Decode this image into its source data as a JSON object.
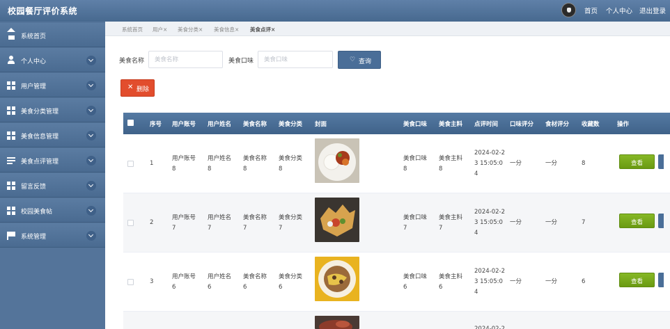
{
  "app": {
    "title": "校园餐厅评价系统"
  },
  "topnav": {
    "home": "首页",
    "profile": "个人中心",
    "logout": "退出登录"
  },
  "sidebar": {
    "items": [
      {
        "label": "系统首页",
        "icon": "home-icon"
      },
      {
        "label": "个人中心",
        "icon": "user-icon"
      },
      {
        "label": "用户管理",
        "icon": "grid-icon"
      },
      {
        "label": "美食分类管理",
        "icon": "grid-icon"
      },
      {
        "label": "美食信息管理",
        "icon": "grid-icon"
      },
      {
        "label": "美食点评管理",
        "icon": "list-icon"
      },
      {
        "label": "留言反馈",
        "icon": "grid-icon"
      },
      {
        "label": "校园美食帖",
        "icon": "grid-icon"
      },
      {
        "label": "系统管理",
        "icon": "flag-icon"
      }
    ]
  },
  "tabs": [
    "系统首页",
    "用户×",
    "美食分类×",
    "美食信息×",
    "美食点评×"
  ],
  "search": {
    "name_label": "美食名称",
    "name_placeholder": "美食名称",
    "taste_label": "美食口味",
    "taste_placeholder": "美食口味",
    "query_button": "查询",
    "delete_button": "删除"
  },
  "table": {
    "headers": [
      "序号",
      "用户账号",
      "用户姓名",
      "美食名称",
      "美食分类",
      "封面",
      "美食口味",
      "美食主料",
      "点评时间",
      "口味评分",
      "食材评分",
      "收藏数",
      "操作"
    ],
    "view_label": "查看",
    "rows": [
      {
        "index": "1",
        "account": [
          "用户账号",
          "8"
        ],
        "name": [
          "用户姓名",
          "8"
        ],
        "food": [
          "美食名称",
          "8"
        ],
        "category": [
          "美食分类",
          "8"
        ],
        "taste": [
          "美食口味",
          "8"
        ],
        "ingredient": [
          "美食主料",
          "8"
        ],
        "time": [
          "2024-02-2",
          "3 15:05:0",
          "4"
        ],
        "taste_score": "一分",
        "ingredient_score": "一分",
        "favorites": "8"
      },
      {
        "index": "2",
        "account": [
          "用户账号",
          "7"
        ],
        "name": [
          "用户姓名",
          "7"
        ],
        "food": [
          "美食名称",
          "7"
        ],
        "category": [
          "美食分类",
          "7"
        ],
        "taste": [
          "美食口味",
          "7"
        ],
        "ingredient": [
          "美食主料",
          "7"
        ],
        "time": [
          "2024-02-2",
          "3 15:05:0",
          "4"
        ],
        "taste_score": "一分",
        "ingredient_score": "一分",
        "favorites": "7"
      },
      {
        "index": "3",
        "account": [
          "用户账号",
          "6"
        ],
        "name": [
          "用户姓名",
          "6"
        ],
        "food": [
          "美食名称",
          "6"
        ],
        "category": [
          "美食分类",
          "6"
        ],
        "taste": [
          "美食口味",
          "6"
        ],
        "ingredient": [
          "美食主料",
          "6"
        ],
        "time": [
          "2024-02-2",
          "3 15:05:0",
          "4"
        ],
        "taste_score": "一分",
        "ingredient_score": "一分",
        "favorites": "6"
      },
      {
        "index": "",
        "account": [
          "",
          ""
        ],
        "name": [
          "",
          ""
        ],
        "food": [
          "",
          ""
        ],
        "category": [
          "",
          ""
        ],
        "taste": [
          "",
          ""
        ],
        "ingredient": [
          "",
          ""
        ],
        "time": [
          "2024-02-2",
          "",
          ""
        ],
        "taste_score": "",
        "ingredient_score": "",
        "favorites": ""
      }
    ]
  },
  "colors": {
    "header": "#4a6e98",
    "view_button": "#7aaa1c",
    "delete_button": "#e24d2d"
  }
}
